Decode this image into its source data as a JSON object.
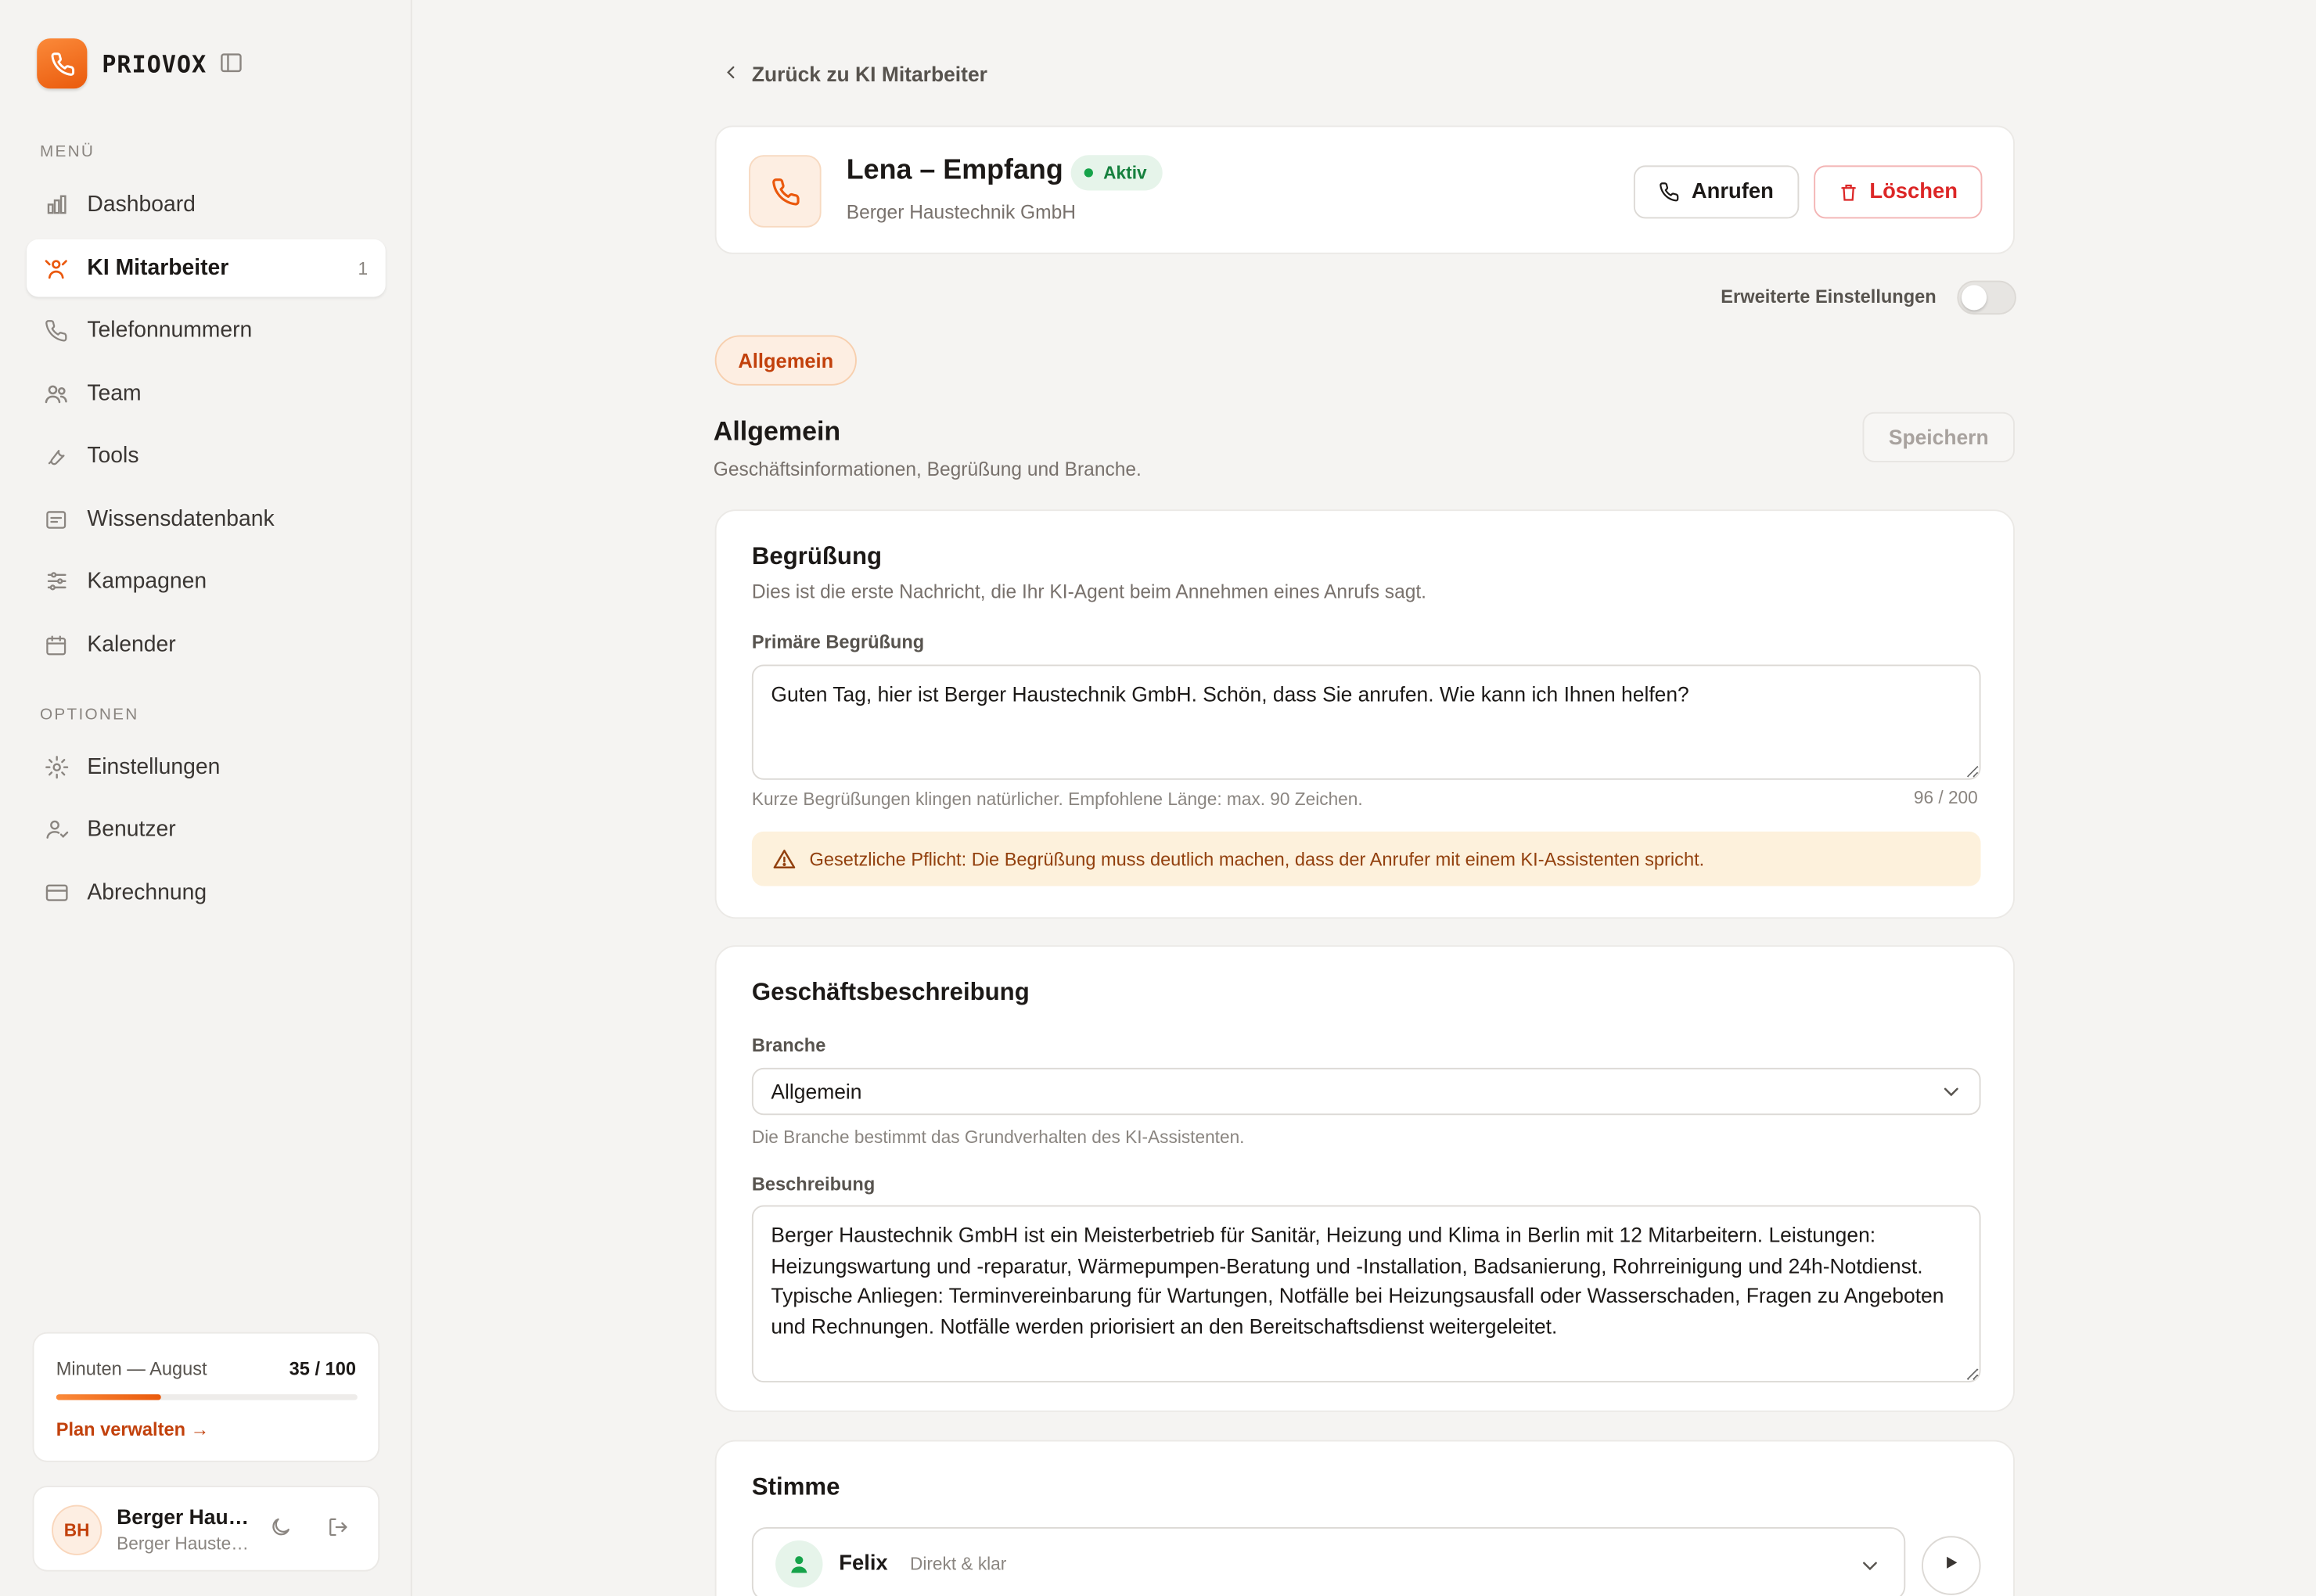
{
  "brand": {
    "name": "PRIOVOX"
  },
  "colors": {
    "accent": "#ea580c",
    "success": "#16a34a",
    "danger": "#dc2626",
    "warning_bg": "#fdf1dc"
  },
  "sidebar": {
    "menu_label": "MENÜ",
    "options_label": "OPTIONEN",
    "menu_items": [
      {
        "label": "Dashboard",
        "icon": "bar-chart-icon"
      },
      {
        "label": "KI Mitarbeiter",
        "icon": "agents-icon",
        "count": "1",
        "active": true
      },
      {
        "label": "Telefonnummern",
        "icon": "phone-icon"
      },
      {
        "label": "Team",
        "icon": "users-icon"
      },
      {
        "label": "Tools",
        "icon": "wrench-icon"
      },
      {
        "label": "Wissensdatenbank",
        "icon": "document-icon"
      },
      {
        "label": "Kampagnen",
        "icon": "sliders-icon"
      },
      {
        "label": "Kalender",
        "icon": "calendar-icon"
      }
    ],
    "option_items": [
      {
        "label": "Einstellungen",
        "icon": "gear-icon"
      },
      {
        "label": "Benutzer",
        "icon": "user-check-icon"
      },
      {
        "label": "Abrechnung",
        "icon": "credit-card-icon"
      }
    ],
    "usage": {
      "title": "Minuten — August",
      "value": "35 / 100",
      "progress": 0.35,
      "link": "Plan verwalten →"
    },
    "user": {
      "initials": "BH",
      "name": "Berger Haustechnik GmbH",
      "sub": "Berger Haustechnik GmbH"
    }
  },
  "main": {
    "back_label": "Zurück zu KI Mitarbeiter",
    "agent": {
      "name": "Lena – Empfang",
      "status": "Aktiv",
      "company": "Berger Haustechnik GmbH"
    },
    "call_button": "Anrufen",
    "delete_button": "Löschen",
    "advanced_settings_label": "Erweiterte Einstellungen",
    "advanced_settings_on": false,
    "tabs": [
      {
        "label": "Allgemein",
        "active": true
      }
    ],
    "section": {
      "title": "Allgemein",
      "subtitle": "Geschäftsinformationen, Begrüßung und Branche.",
      "save_button": "Speichern"
    },
    "greeting": {
      "title": "Begrüßung",
      "subtitle": "Dies ist die erste Nachricht, die Ihr KI-Agent beim Annehmen eines Anrufs sagt.",
      "field_label": "Primäre Begrüßung",
      "value": "Guten Tag, hier ist Berger Haustechnik GmbH. Schön, dass Sie anrufen. Wie kann ich Ihnen helfen?",
      "hint": "Kurze Begrüßungen klingen natürlicher. Empfohlene Länge: max. 90 Zeichen.",
      "counter": "96 / 200",
      "warning": "Gesetzliche Pflicht: Die Begrüßung muss deutlich machen, dass der Anrufer mit einem KI-Assistenten spricht."
    },
    "business": {
      "title": "Geschäftsbeschreibung",
      "industry_label": "Branche",
      "industry_value": "Allgemein",
      "industry_hint": "Die Branche bestimmt das Grundverhalten des KI-Assistenten.",
      "description_label": "Beschreibung",
      "description_value": "Berger Haustechnik GmbH ist ein Meisterbetrieb für Sanitär, Heizung und Klima in Berlin mit 12 Mitarbeitern. Leistungen: Heizungswartung und -reparatur, Wärmepumpen-Beratung und -Installation, Badsanierung, Rohrreinigung und 24h-Notdienst. Typische Anliegen: Terminvereinbarung für Wartungen, Notfälle bei Heizungsausfall oder Wasserschaden, Fragen zu Angeboten und Rechnungen. Notfälle werden priorisiert an den Bereitschaftsdienst weitergeleitet."
    },
    "voice": {
      "title": "Stimme",
      "name": "Felix",
      "description": "Direkt & klar"
    }
  }
}
